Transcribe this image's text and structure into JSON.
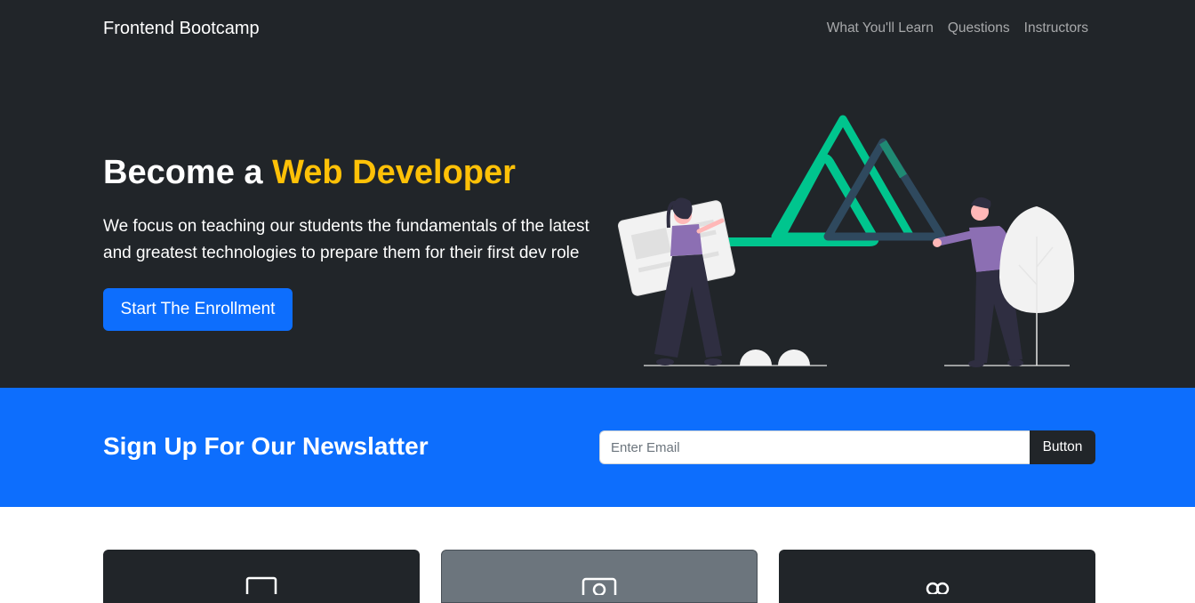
{
  "navbar": {
    "brand": "Frontend Bootcamp",
    "links": [
      {
        "label": "What You'll Learn"
      },
      {
        "label": "Questions"
      },
      {
        "label": "Instructors"
      }
    ]
  },
  "hero": {
    "title_prefix": "Become a ",
    "title_accent": "Web Developer",
    "lead": "We focus on teaching our students the fundamentals of the latest and greatest technologies to prepare them for their first dev role",
    "cta_label": "Start The Enrollment"
  },
  "newsletter": {
    "title": "Sign Up For Our Newslatter",
    "email_placeholder": "Enter Email",
    "button_label": "Button"
  },
  "boxes": [
    {
      "icon": "laptop-icon",
      "color": "#212529"
    },
    {
      "icon": "person-badge-icon",
      "color": "#6c757d"
    },
    {
      "icon": "people-icon",
      "color": "#212529"
    }
  ],
  "colors": {
    "dark": "#212529",
    "primary": "#0d6efd",
    "warning": "#ffc107",
    "vue_green": "#00c58e",
    "vue_dark": "#2f495e",
    "figure_purple": "#8c6fb3"
  }
}
